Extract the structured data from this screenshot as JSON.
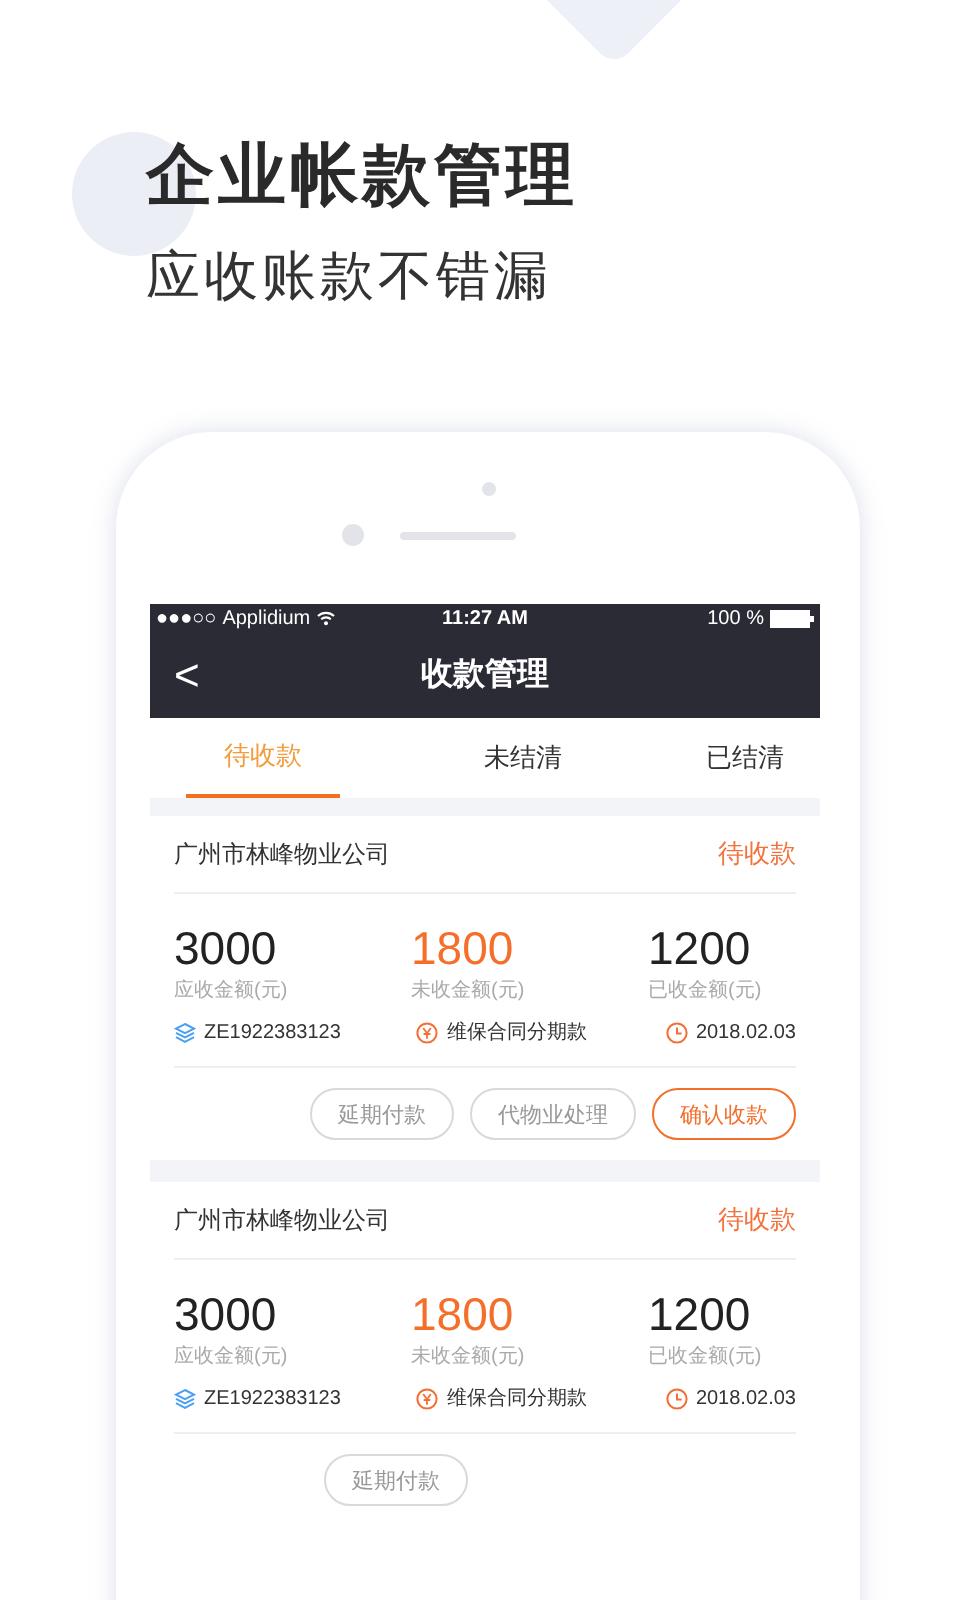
{
  "headline": "企业帐款管理",
  "subtitle": "应收账款不错漏",
  "status_bar": {
    "signal": "●●●○○",
    "carrier": "Applidium",
    "time": "11:27 AM",
    "battery": "100 %"
  },
  "nav": {
    "back": "<",
    "title": "收款管理"
  },
  "tabs": [
    {
      "label": "待收款",
      "selected": true
    },
    {
      "label": "未结清",
      "selected": false
    },
    {
      "label": "已结清",
      "selected": false
    }
  ],
  "cards": [
    {
      "company": "广州市林峰物业公司",
      "status": "待收款",
      "amounts": [
        {
          "value": "3000",
          "label": "应收金额(元)",
          "kind": "due"
        },
        {
          "value": "1800",
          "label": "未收金额(元)",
          "kind": "unpaid"
        },
        {
          "value": "1200",
          "label": "已收金额(元)",
          "kind": "paid"
        }
      ],
      "meta": [
        {
          "kind": "code",
          "text": "ZE1922383123"
        },
        {
          "kind": "type",
          "text": "维保合同分期款"
        },
        {
          "kind": "date",
          "text": "2018.02.03"
        }
      ],
      "buttons": [
        {
          "label": "延期付款",
          "kind": "secondary"
        },
        {
          "label": "代物业处理",
          "kind": "secondary"
        },
        {
          "label": "确认收款",
          "kind": "primary"
        }
      ]
    },
    {
      "company": "广州市林峰物业公司",
      "status": "待收款",
      "amounts": [
        {
          "value": "3000",
          "label": "应收金额(元)",
          "kind": "due"
        },
        {
          "value": "1800",
          "label": "未收金额(元)",
          "kind": "unpaid"
        },
        {
          "value": "1200",
          "label": "已收金额(元)",
          "kind": "paid"
        }
      ],
      "meta": [
        {
          "kind": "code",
          "text": "ZE1922383123"
        },
        {
          "kind": "type",
          "text": "维保合同分期款"
        },
        {
          "kind": "date",
          "text": "2018.02.03"
        }
      ],
      "buttons": [
        {
          "label": "延期付款",
          "kind": "secondary"
        }
      ]
    }
  ]
}
